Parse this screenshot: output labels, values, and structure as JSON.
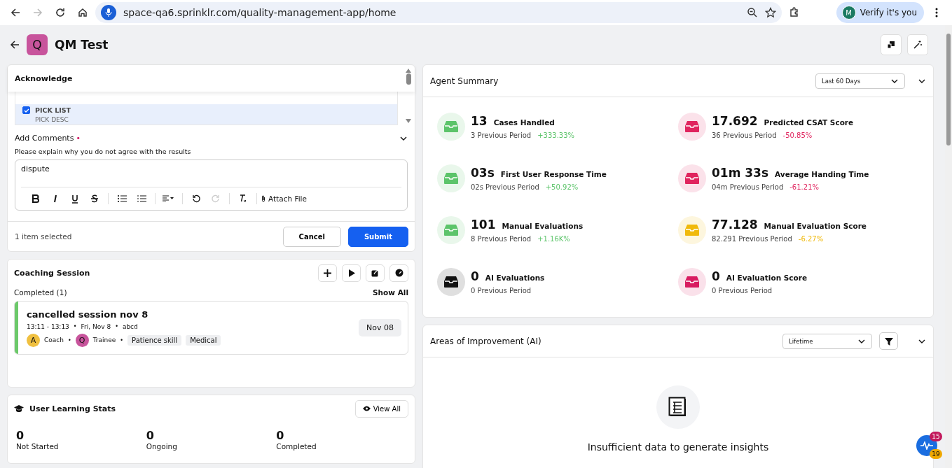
{
  "browser": {
    "url": "space-qa6.sprinklr.com/quality-management-app/home",
    "forward_disabled": true,
    "profile_initial": "M",
    "profile_label": "Verify it's you"
  },
  "page": {
    "avatar": "Q",
    "title": "QM Test"
  },
  "acknowledge": {
    "title": "Acknowledge",
    "items": [
      {
        "label": "PICK LIST",
        "description": "PICK DESC",
        "checked": true
      }
    ],
    "comments_label": "Add Comments",
    "required_mark": "•",
    "hint": "Please explain why you do not agree with the results",
    "value": "dispute",
    "attach": "Attach File",
    "selection": "1 item selected",
    "cancel": "Cancel",
    "submit": "Submit"
  },
  "coaching": {
    "title": "Coaching Session",
    "group": "Completed (1)",
    "show_all": "Show All",
    "sessions": [
      {
        "title": "cancelled session nov 8",
        "time": "13:11 - 13:13",
        "day": "Fri, Nov 8",
        "note": "abcd",
        "separator": "•",
        "coach_initial": "A",
        "coach": "Coach",
        "trainee_initial": "Q",
        "trainee": "Trainee",
        "tags": [
          "Patience skill",
          "Medical"
        ],
        "date": "Nov 08",
        "color": "#6cc96a"
      }
    ]
  },
  "learning": {
    "title": "User Learning Stats",
    "view_all": "View All",
    "stats": [
      {
        "value": "0",
        "label": "Not Started"
      },
      {
        "value": "0",
        "label": "Ongoing"
      },
      {
        "value": "0",
        "label": "Completed"
      }
    ]
  },
  "agent_summary": {
    "title": "Agent Summary",
    "period": "Last 60 Days",
    "metrics": [
      {
        "value": "13",
        "label": "Cases Handled",
        "previous": "3 Previous Period",
        "change": "+333.33%",
        "color": "#5cc46a"
      },
      {
        "value": "17.692",
        "label": "Predicted CSAT Score",
        "previous": "36 Previous Period",
        "change": "-50.85%",
        "color": "#e0245e"
      },
      {
        "value": "03s",
        "label": "First User Response Time",
        "previous": "02s Previous Period",
        "change": "+50.92%",
        "color": "#5cc46a"
      },
      {
        "value": "01m 33s",
        "label": "Average Handing Time",
        "previous": "04m Previous Period",
        "change": "-61.21%",
        "color": "#e0245e"
      },
      {
        "value": "101",
        "label": "Manual Evaluations",
        "previous": "8 Previous Period",
        "change": "+1.16K%",
        "color": "#5cc46a"
      },
      {
        "value": "77.128",
        "label": "Manual Evaluation Score",
        "previous": "82.291 Previous Period",
        "change": "-6.27%",
        "color": "#f0b90b"
      },
      {
        "value": "0",
        "label": "AI Evaluations",
        "previous": "0 Previous Period",
        "color": "#111111"
      },
      {
        "value": "0",
        "label": "AI Evaluation Score",
        "previous": "0 Previous Period",
        "color": "#d81b60"
      }
    ]
  },
  "improvement": {
    "title": "Areas of Improvement (AI)",
    "period": "Lifetime",
    "empty_message": "Insufficient data to generate insights"
  },
  "fab": {
    "badges": [
      {
        "count": "15",
        "color": "#c2185b"
      },
      {
        "count": "19",
        "color": "#f0a800"
      }
    ]
  }
}
